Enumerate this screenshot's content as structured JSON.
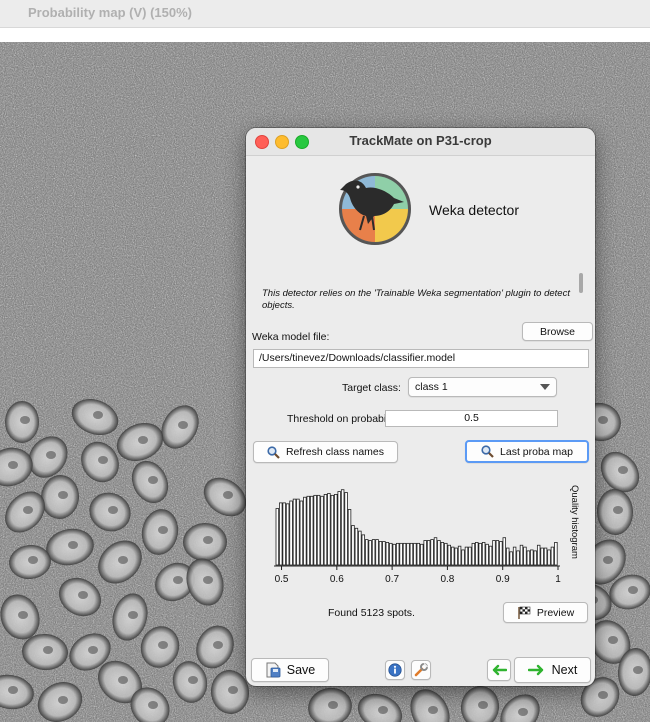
{
  "background_window": {
    "title": "Probability map (V) (150%)"
  },
  "dialog": {
    "title": "TrackMate on P31-crop",
    "detector_title": "Weka detector",
    "logo_icon": "weka-bird-logo",
    "description": "This detector relies on the 'Trainable Weka segmentation' plugin to detect objects.",
    "model_file": {
      "label": "Weka model file:",
      "browse_label": "Browse",
      "value": "/Users/tinevez/Downloads/classifier.model"
    },
    "target_class": {
      "label": "Target class:",
      "selected": "class 1"
    },
    "threshold": {
      "label": "Threshold on probability:",
      "value": "0.5"
    },
    "buttons": {
      "refresh_label": "Refresh class names",
      "last_proba_label": "Last proba map",
      "preview_label": "Preview",
      "save_label": "Save",
      "next_label": "Next"
    },
    "histogram": {
      "side_label": "Quality histogram",
      "x_ticks": [
        "0.5",
        "0.6",
        "0.7",
        "0.8",
        "0.9",
        "1"
      ]
    },
    "found_text": "Found 5123 spots."
  },
  "chart_data": {
    "type": "bar",
    "title": "",
    "ylabel": "Quality histogram",
    "xlabel": "",
    "xlim": [
      0.49,
      1.0
    ],
    "x_ticks": [
      0.5,
      0.6,
      0.7,
      0.8,
      0.9,
      1.0
    ],
    "values": [
      60,
      66,
      66,
      65,
      68,
      70,
      70,
      68,
      72,
      73,
      73,
      74,
      74,
      73,
      75,
      76,
      74,
      75,
      78,
      80,
      77,
      59,
      42,
      39,
      36,
      32,
      27,
      26,
      27,
      27,
      25,
      25,
      24,
      23,
      22,
      23,
      23,
      23,
      23,
      23,
      23,
      23,
      22,
      26,
      26,
      27,
      29,
      26,
      24,
      23,
      21,
      19,
      18,
      20,
      16,
      19,
      19,
      23,
      24,
      23,
      24,
      22,
      20,
      26,
      26,
      25,
      29,
      18,
      14,
      19,
      15,
      21,
      19,
      15,
      16,
      15,
      21,
      18,
      18,
      16,
      19,
      24
    ],
    "ylim": [
      0,
      85
    ]
  },
  "colors": {
    "dialog_bg": "#ececec",
    "close": "#ff5f57",
    "minimize": "#febc2e",
    "maximize": "#28c840",
    "focus_ring": "#5b9af5",
    "next_arrow": "#2fb32f"
  }
}
